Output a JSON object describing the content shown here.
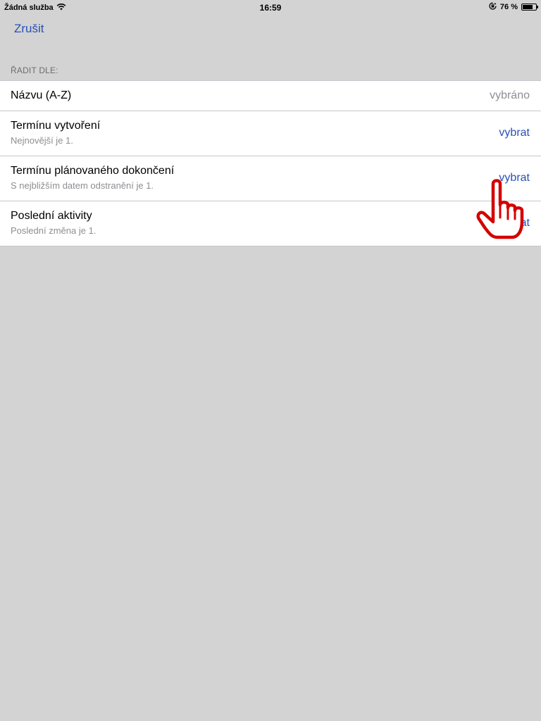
{
  "status_bar": {
    "carrier": "Žádná služba",
    "time": "16:59",
    "battery_percent_text": "76 %",
    "battery_level": 0.76,
    "icons": [
      "wifi-icon",
      "rotation-lock-icon",
      "battery-icon"
    ]
  },
  "nav": {
    "cancel_label": "Zrušit"
  },
  "section": {
    "header": "ŘADIT DLE:"
  },
  "options": [
    {
      "title": "Názvu (A-Z)",
      "subtitle": "",
      "action": "vybráno",
      "selected": true
    },
    {
      "title": "Termínu vytvoření",
      "subtitle": "Nejnovější je 1.",
      "action": "vybrat",
      "selected": false
    },
    {
      "title": "Termínu plánovaného dokončení",
      "subtitle": "S nejbližším datem odstranění je 1.",
      "action": "vybrat",
      "selected": false
    },
    {
      "title": "Poslední aktivity",
      "subtitle": "Poslední změna je 1.",
      "action": "vybrat",
      "selected": false
    }
  ],
  "colors": {
    "background": "#d3d3d3",
    "accent": "#2a4fb4",
    "secondary_text": "#8e8e93",
    "pointer": "#d40000"
  }
}
